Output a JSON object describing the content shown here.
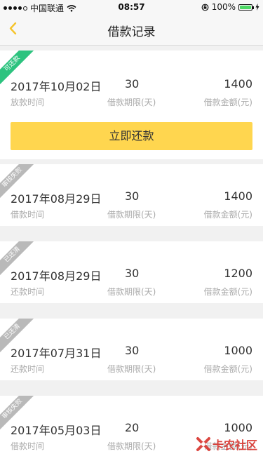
{
  "status_bar": {
    "carrier": "中国联通",
    "time": "08:57",
    "battery": "100%",
    "battery_fill": 1.0
  },
  "nav": {
    "title": "借款记录",
    "back_icon": "chevron-left-icon",
    "accent": "#f5c42c"
  },
  "records": [
    {
      "badge": "可还款",
      "badge_color": "#2dc37f",
      "date": "2017年10月02日",
      "date_label": "放款时间",
      "term": "30",
      "term_label": "借款期限(天)",
      "amount": "1400",
      "amount_label": "借款金额(元)",
      "button_label": "立即还款"
    },
    {
      "badge": "审核失败",
      "badge_color": "#b9b9b9",
      "date": "2017年08月29日",
      "date_label": "借款时间",
      "term": "30",
      "term_label": "借款期限(天)",
      "amount": "1400",
      "amount_label": "借款金额(元)"
    },
    {
      "badge": "已还清",
      "badge_color": "#b9b9b9",
      "date": "2017年08月29日",
      "date_label": "还款时间",
      "term": "30",
      "term_label": "借款期限(天)",
      "amount": "1200",
      "amount_label": "借款金额(元)"
    },
    {
      "badge": "已还清",
      "badge_color": "#b9b9b9",
      "date": "2017年07月31日",
      "date_label": "还款时间",
      "term": "30",
      "term_label": "借款期限(天)",
      "amount": "1000",
      "amount_label": "借款金额(元)"
    },
    {
      "badge": "审核失败",
      "badge_color": "#b9b9b9",
      "date": "2017年05月03日",
      "date_label": "借款时间",
      "term": "20",
      "term_label": "借款期限(天)",
      "amount": "1000",
      "amount_label": "借款金额(元)"
    }
  ],
  "watermark": {
    "text": "卡农社区",
    "color": "#d8332c"
  }
}
